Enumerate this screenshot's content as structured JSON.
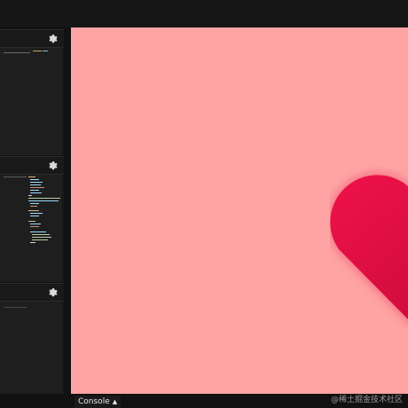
{
  "editor": {
    "panels": [
      {
        "name": "html-panel",
        "settings_icon": "gear-icon"
      },
      {
        "name": "css-panel",
        "settings_icon": "gear-icon"
      },
      {
        "name": "js-panel",
        "settings_icon": "gear-icon"
      }
    ]
  },
  "preview": {
    "background_color": "#ffa4a4",
    "heart_color": "#d50d3e",
    "heart_icon": "heart-icon"
  },
  "bottom": {
    "console_label": "Console",
    "console_icon": "chevron-up-icon",
    "watermark": "@稀土掘金技术社区"
  }
}
